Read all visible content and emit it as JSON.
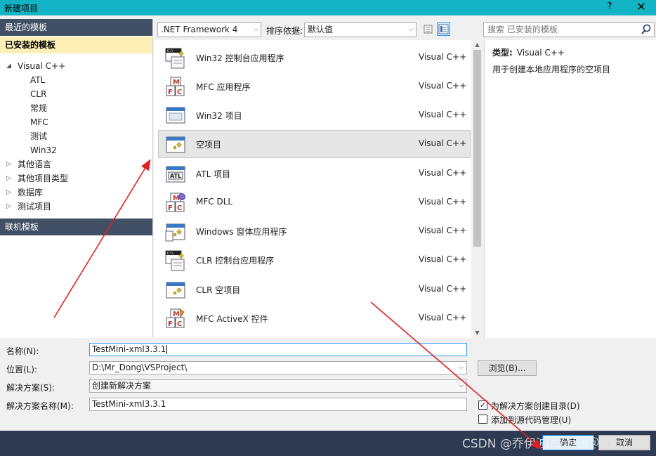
{
  "window": {
    "title": "新建项目",
    "help_label": "?",
    "close_label": "✕"
  },
  "left_panel": {
    "recent_templates": "最近的模板",
    "installed_templates": "已安装的模板",
    "online_templates": "联机模板",
    "tree": [
      {
        "label": "Visual C++",
        "arrow": "◢",
        "expanded": true
      },
      {
        "label": "其他语言",
        "arrow": "▷"
      },
      {
        "label": "其他项目类型",
        "arrow": "▷"
      },
      {
        "label": "数据库",
        "arrow": "▷"
      },
      {
        "label": "测试项目",
        "arrow": "▷"
      }
    ],
    "vc_children": [
      "ATL",
      "CLR",
      "常规",
      "MFC",
      "测试",
      "Win32"
    ]
  },
  "toolbar": {
    "framework": ".NET Framework 4",
    "sort_label": "排序依据:",
    "sort_value": "默认值",
    "dropdown_glyph": "⌵"
  },
  "search": {
    "placeholder": "搜索 已安装的模板"
  },
  "templates": [
    {
      "name": "Win32 控制台应用程序",
      "lang": "Visual C++",
      "icon": "console-app-icon"
    },
    {
      "name": "MFC 应用程序",
      "lang": "Visual C++",
      "icon": "mfc-icon"
    },
    {
      "name": "Win32 项目",
      "lang": "Visual C++",
      "icon": "window-icon"
    },
    {
      "name": "空项目",
      "lang": "Visual C++",
      "icon": "empty-project-icon",
      "selected": true
    },
    {
      "name": "ATL 项目",
      "lang": "Visual C++",
      "icon": "atl-icon"
    },
    {
      "name": "MFC DLL",
      "lang": "Visual C++",
      "icon": "mfc-dll-icon"
    },
    {
      "name": "Windows 窗体应用程序",
      "lang": "Visual C++",
      "icon": "winforms-icon"
    },
    {
      "name": "CLR 控制台应用程序",
      "lang": "Visual C++",
      "icon": "console-app-icon"
    },
    {
      "name": "CLR 空项目",
      "lang": "Visual C++",
      "icon": "empty-project-icon"
    },
    {
      "name": "MFC ActiveX 控件",
      "lang": "Visual C++",
      "icon": "activex-icon"
    }
  ],
  "info": {
    "type_label": "类型:",
    "type_value": "Visual C++",
    "description": "用于创建本地应用程序的空项目"
  },
  "form": {
    "name_label": "名称(N):",
    "name_value": "TestMini-xml3.3.1",
    "location_label": "位置(L):",
    "location_value": "D:\\Mr_Dong\\VSProject\\",
    "solution_label": "解决方案(S):",
    "solution_value": "创建新解决方案",
    "solution_name_label": "解决方案名称(M):",
    "solution_name_value": "TestMini-xml3.3.1",
    "browse_label": "浏览(B)...",
    "create_dir_label": "为解决方案创建目录(D)",
    "create_dir_checked": "✓",
    "source_control_label": "添加到源代码管理(U)",
    "ok_label": "确定",
    "cancel_label": "取消"
  },
  "watermark": "CSDN @乔伊波伊o(*^＠^)o",
  "colors": {
    "title_bar": "#12b3c4",
    "section_header": "#425066",
    "installed_highlight": "#fdf0b7",
    "footer": "#2d3a52",
    "annotation_arrow": "#e02020"
  }
}
